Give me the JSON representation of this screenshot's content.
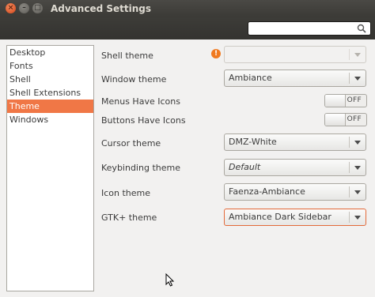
{
  "window": {
    "title": "Advanced Settings",
    "close_glyph": "×",
    "minimize_glyph": "–",
    "maximize_glyph": "□"
  },
  "search": {
    "value": "",
    "placeholder": ""
  },
  "sidebar": {
    "items": [
      {
        "label": "Desktop"
      },
      {
        "label": "Fonts"
      },
      {
        "label": "Shell"
      },
      {
        "label": "Shell Extensions"
      },
      {
        "label": "Theme"
      },
      {
        "label": "Windows"
      }
    ],
    "selected": "Theme"
  },
  "settings": {
    "shell_theme": {
      "label": "Shell theme",
      "value": "",
      "warning": "!"
    },
    "window_theme": {
      "label": "Window theme",
      "value": "Ambiance"
    },
    "menus_icons": {
      "label": "Menus Have Icons",
      "state": "OFF"
    },
    "buttons_icons": {
      "label": "Buttons Have Icons",
      "state": "OFF"
    },
    "cursor_theme": {
      "label": "Cursor theme",
      "value": "DMZ-White"
    },
    "keybinding_theme": {
      "label": "Keybinding theme",
      "value": "Default"
    },
    "icon_theme": {
      "label": "Icon theme",
      "value": "Faenza-Ambiance"
    },
    "gtk_theme": {
      "label": "GTK+ theme",
      "value": "Ambiance Dark Sidebar"
    }
  },
  "colors": {
    "accent": "#f07746",
    "titlebar": "#3c3b37"
  }
}
